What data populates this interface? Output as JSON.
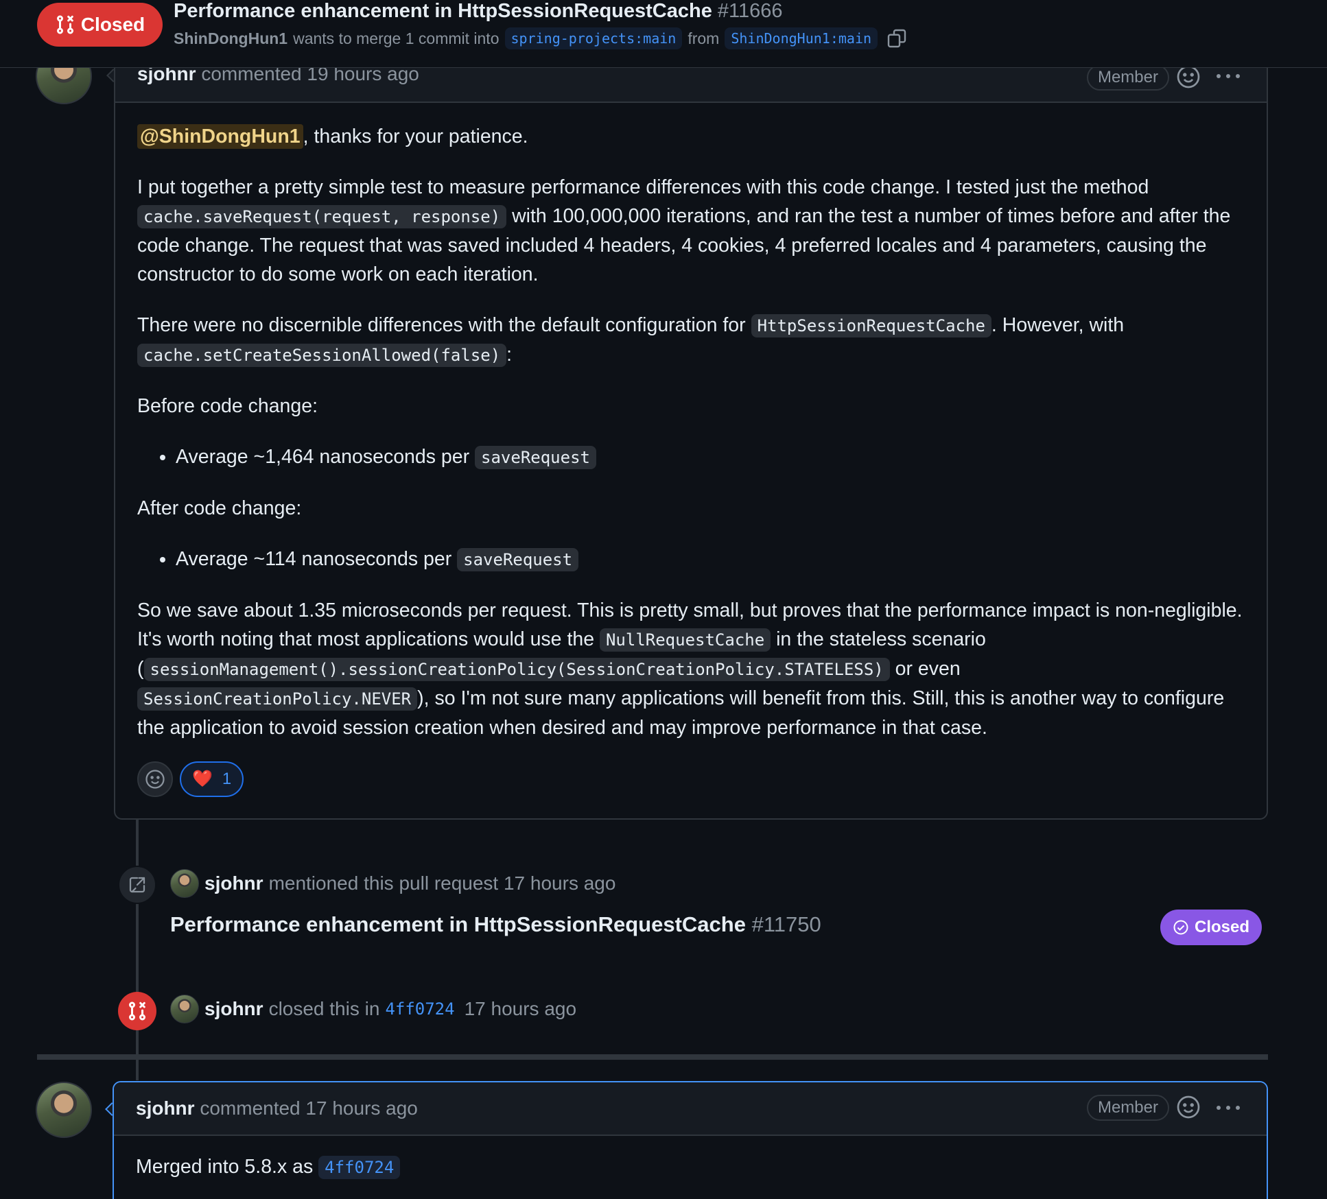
{
  "header": {
    "state": "Closed",
    "title": "Performance enhancement in HttpSessionRequestCache",
    "number": "#11666",
    "author": "ShinDongHun1",
    "merge_text": "wants to merge 1 commit into",
    "base_branch": "spring-projects:main",
    "from_text": "from",
    "head_branch": "ShinDongHun1:main"
  },
  "comment1": {
    "author": "sjohnr",
    "meta": "commented 19 hours ago",
    "badge": "Member",
    "mention": "@ShinDongHun1",
    "p1_rest": ", thanks for your patience.",
    "p2_a": "I put together a pretty simple test to measure performance differences with this code change. I tested just the method ",
    "p2_code": "cache.saveRequest(request, response)",
    "p2_b": " with 100,000,000 iterations, and ran the test a number of times before and after the code change. The request that was saved included 4 headers, 4 cookies, 4 preferred locales and 4 parameters, causing the constructor to do some work on each iteration.",
    "p3_a": "There were no discernible differences with the default configuration for ",
    "p3_code1": "HttpSessionRequestCache",
    "p3_b": ". However, with ",
    "p3_code2": "cache.setCreateSessionAllowed(false)",
    "p3_c": ":",
    "before_label": "Before code change:",
    "before_item": "Average ~1,464 nanoseconds per ",
    "before_code": "saveRequest",
    "after_label": "After code change:",
    "after_item": "Average ~114 nanoseconds per ",
    "after_code": "saveRequest",
    "p4_a": "So we save about 1.35 microseconds per request. This is pretty small, but proves that the performance impact is non-negligible. It's worth noting that most applications would use the ",
    "p4_code1": "NullRequestCache",
    "p4_b": " in the stateless scenario (",
    "p4_code2": "sessionManagement().sessionCreationPolicy(SessionCreationPolicy.STATELESS)",
    "p4_c": " or even ",
    "p4_code3": "SessionCreationPolicy.NEVER",
    "p4_d": "), so I'm not sure many applications will benefit from this. Still, this is another way to configure the application to avoid session creation when desired and may improve performance in that case.",
    "reaction_emoji": "❤️",
    "reaction_count": "1"
  },
  "event_mention": {
    "author": "sjohnr",
    "text": "mentioned this pull request 17 hours ago",
    "ref_title": "Performance enhancement in HttpSessionRequestCache",
    "ref_number": "#11750",
    "ref_state": "Closed"
  },
  "event_closed": {
    "author": "sjohnr",
    "text_a": "closed this in",
    "sha": "4ff0724",
    "text_b": "17 hours ago"
  },
  "comment2": {
    "author": "sjohnr",
    "meta": "commented 17 hours ago",
    "badge": "Member",
    "body_text": "Merged into 5.8.x as ",
    "body_sha": "4ff0724"
  },
  "colors": {
    "closed_red": "#da3633",
    "merged_purple": "#8957e5",
    "link_blue": "#4493f8",
    "background": "#0d1117"
  },
  "icons": [
    "git-pull-request-closed-icon",
    "copy-icon",
    "smiley-icon",
    "kebab-horizontal-icon",
    "cross-reference-icon",
    "check-circle-icon"
  ]
}
